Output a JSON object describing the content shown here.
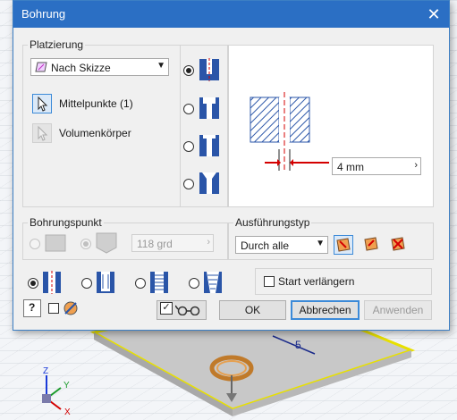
{
  "dialog": {
    "title": "Bohrung",
    "close_icon": "close-icon"
  },
  "placement": {
    "group_label": "Platzierung",
    "method_value": "Nach Skizze",
    "centerpoints_label": "Mittelpunkte (1)",
    "solids_label": "Volumenkörper"
  },
  "preview": {
    "diameter_value": "4 mm"
  },
  "drill_point": {
    "group_label": "Bohrungspunkt",
    "angle_value": "118 grd"
  },
  "termination": {
    "group_label": "Ausführungstyp",
    "value": "Durch alle"
  },
  "options": {
    "extend_start_label": "Start verlängern"
  },
  "buttons": {
    "ok": "OK",
    "cancel": "Abbrechen",
    "apply": "Anwenden"
  },
  "viewport": {
    "dimension_label": "5",
    "axis_x": "X",
    "axis_y": "Y",
    "axis_z": "Z"
  },
  "colors": {
    "titlebar": "#2b6fc4",
    "accent": "#3c8ad8",
    "arrow_red": "#d40000",
    "hatch_blue": "#2a55a8",
    "highlight_yellow": "#e8e000"
  }
}
